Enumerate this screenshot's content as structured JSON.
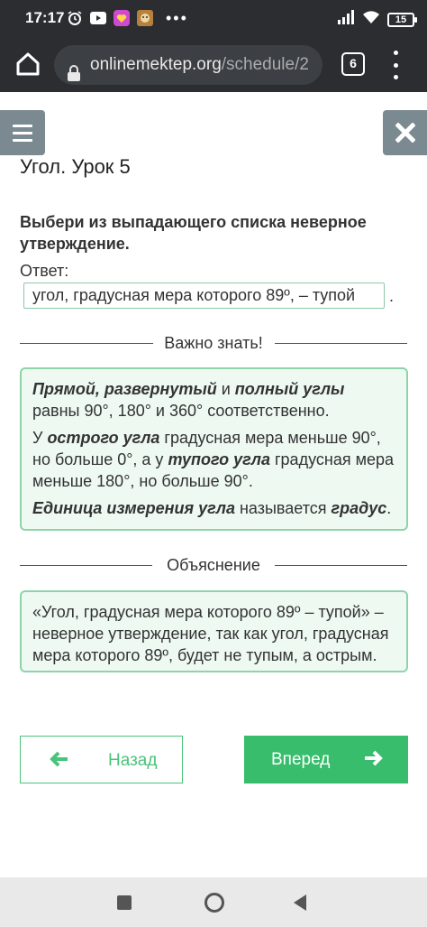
{
  "status_bar": {
    "time": "17:17",
    "battery": "15",
    "icons": [
      "alarm-icon",
      "youtube-icon",
      "app-icon",
      "app-icon-2",
      "more-icon",
      "signal-icon",
      "wifi-icon",
      "battery-icon"
    ]
  },
  "browser": {
    "url_domain": "onlinemektep.org",
    "url_path": "/schedule/2",
    "tab_count": "6"
  },
  "page": {
    "lesson_title": "Угол. Урок 5",
    "question": "Выбери из выпадающего списка неверное утверждение.",
    "answer_label": "Ответ:",
    "answer_value": "угол, градусная мера которого 89º, – тупой",
    "answer_suffix": "."
  },
  "important": {
    "heading": "Важно знать!",
    "p1_b1": "Прямой, развернутый",
    "p1_t1": " и ",
    "p1_b2": "полный углы",
    "p1_t2": " равны 90°, 180° и 360° соответственно.",
    "p2_t1": "У ",
    "p2_b1": "острого угла",
    "p2_t2": " градусная мера меньше 90°, но больше 0°, а у ",
    "p2_b2": "тупого угла",
    "p2_t3": " градусная мера меньше 180°, но больше 90°.",
    "p3_b1": "Единица измерения угла",
    "p3_t1": " называется ",
    "p3_b2": "градус",
    "p3_t2": "."
  },
  "explanation": {
    "heading": "Объяснение",
    "text": "«Угол, градусная мера которого 89º – тупой» – неверное утверждение, так как угол, градусная мера которого 89º, будет не тупым, а острым."
  },
  "nav": {
    "back_label": "Назад",
    "next_label": "Вперед"
  },
  "colors": {
    "accent_green": "#37bd6b",
    "info_border": "#8fd3ab",
    "info_bg": "#eef9f2",
    "side_button": "#7a8a90"
  }
}
